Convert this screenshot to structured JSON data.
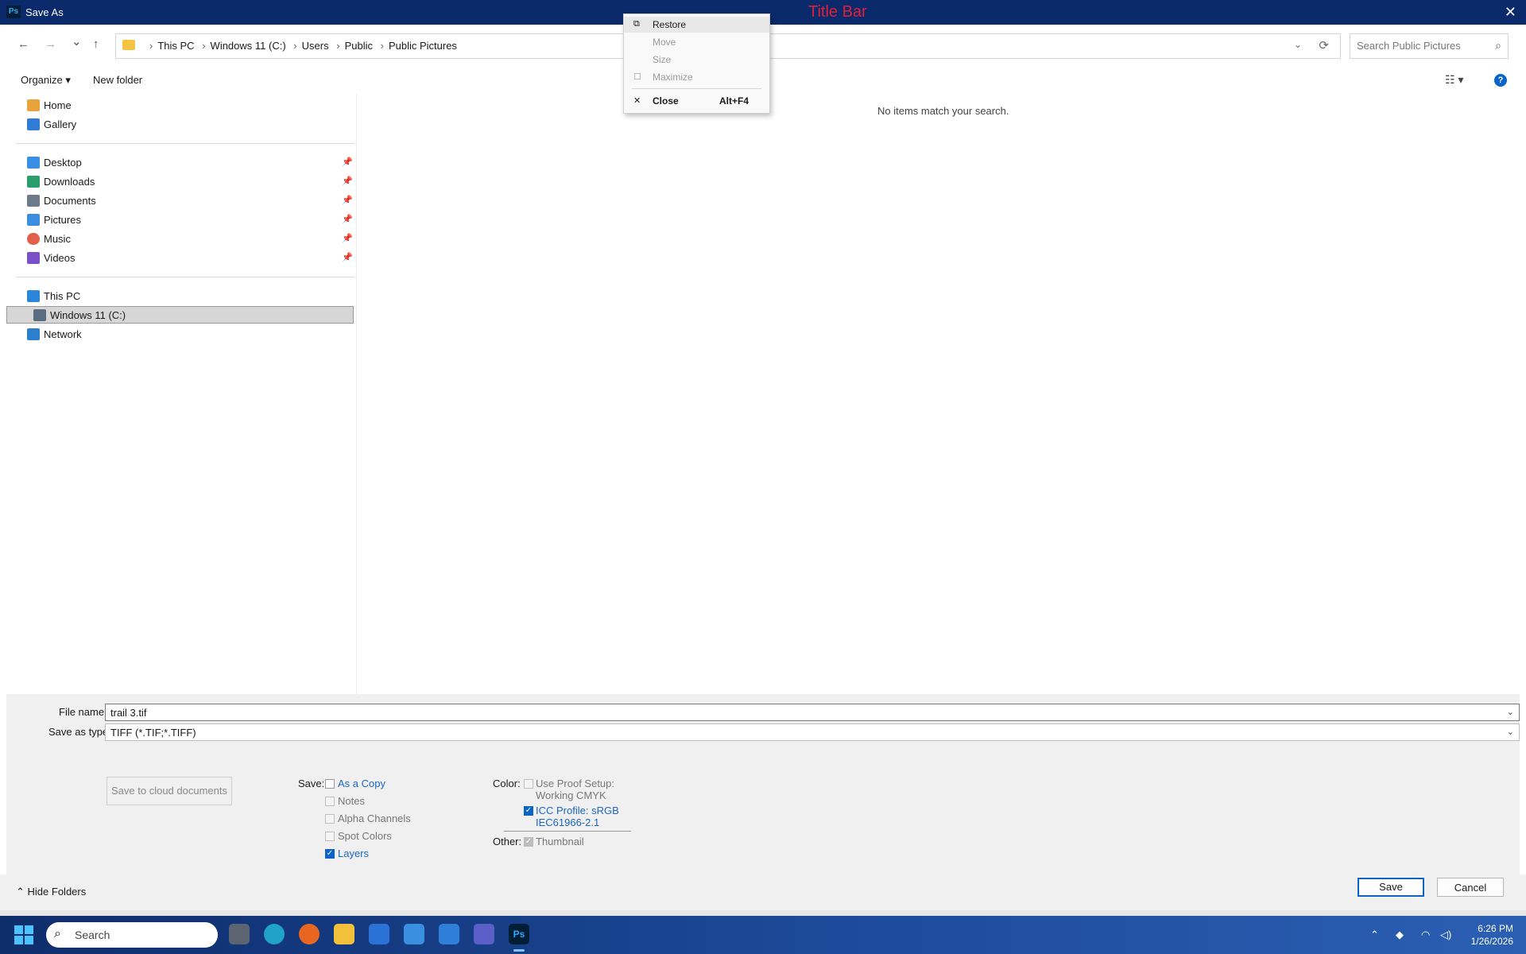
{
  "window": {
    "title": "Save As",
    "overlay_label": "Title Bar",
    "app_badge": "Ps",
    "close_glyph": "✕"
  },
  "nav": {
    "back_glyph": "←",
    "forward_glyph": "→",
    "recent_glyph": "⌄",
    "up_glyph": "↑",
    "breadcrumbs": [
      "This PC",
      "Windows 11 (C:)",
      "Users",
      "Public",
      "Public Pictures"
    ],
    "sep_glyph": "›",
    "search_placeholder": "Search Public Pictures"
  },
  "toolbar": {
    "organize": "Organize ▾",
    "new_folder": "New folder",
    "help": "?"
  },
  "sidebar": {
    "quick": [
      {
        "label": "Home",
        "icon": "home-icon",
        "color": "#e8a33c"
      },
      {
        "label": "Gallery",
        "icon": "gallery-icon",
        "color": "#2f7bd6"
      }
    ],
    "pinned": [
      {
        "label": "Desktop",
        "icon": "desktop-icon",
        "color": "#3a8ee6"
      },
      {
        "label": "Downloads",
        "icon": "downloads-icon",
        "color": "#2a9d6a"
      },
      {
        "label": "Documents",
        "icon": "documents-icon",
        "color": "#6c7a8a"
      },
      {
        "label": "Pictures",
        "icon": "pictures-icon",
        "color": "#3b8de0"
      },
      {
        "label": "Music",
        "icon": "music-icon",
        "color": "#e2604a"
      },
      {
        "label": "Videos",
        "icon": "videos-icon",
        "color": "#7b4fc9"
      }
    ],
    "pin_glyph": "📌",
    "pc": [
      {
        "label": "This PC",
        "icon": "this-pc-icon",
        "color": "#2b86d9"
      },
      {
        "label": "Windows 11 (C:)",
        "icon": "drive-icon",
        "color": "#5a6c80",
        "selected": true
      },
      {
        "label": "Network",
        "icon": "network-icon",
        "color": "#2c7fcf"
      }
    ]
  },
  "content": {
    "empty_message": "No items match your search."
  },
  "fields": {
    "file_name_label": "File name:",
    "file_name_value": "trail 3.tif",
    "save_type_label": "Save as type:",
    "save_type_value": "TIFF (*.TIF;*.TIFF)"
  },
  "options": {
    "cloud_button": "Save to cloud documents",
    "save_label": "Save:",
    "save_items": [
      {
        "label": "As a Copy",
        "checked": false,
        "enabled": true
      },
      {
        "label": "Notes",
        "checked": false,
        "enabled": false
      },
      {
        "label": "Alpha Channels",
        "checked": false,
        "enabled": false
      },
      {
        "label": "Spot Colors",
        "checked": false,
        "enabled": false
      },
      {
        "label": "Layers",
        "checked": true,
        "enabled": true
      }
    ],
    "color_label": "Color:",
    "proof_line1": "Use Proof Setup:",
    "proof_line2": "Working CMYK",
    "icc_line1": "ICC Profile:  sRGB",
    "icc_line2": "IEC61966-2.1",
    "other_label": "Other:",
    "thumbnail": "Thumbnail"
  },
  "footer": {
    "hide_folders": "Hide Folders",
    "save": "Save",
    "cancel": "Cancel"
  },
  "context_menu": {
    "items": [
      {
        "label": "Restore",
        "glyph": "⧉",
        "enabled": true
      },
      {
        "label": "Move",
        "glyph": "",
        "enabled": false
      },
      {
        "label": "Size",
        "glyph": "",
        "enabled": false
      },
      {
        "label": "Maximize",
        "glyph": "☐",
        "enabled": false
      },
      {
        "label": "Close",
        "glyph": "✕",
        "shortcut": "Alt+F4",
        "enabled": true
      }
    ]
  },
  "taskbar": {
    "search_placeholder": "Search",
    "time": "6:26 PM",
    "date": "1/26/2026",
    "apps": [
      {
        "name": "task-view",
        "color": "#5b6470"
      },
      {
        "name": "edge",
        "color": "#1fa3c9"
      },
      {
        "name": "firefox",
        "color": "#e8661f"
      },
      {
        "name": "file-explorer",
        "color": "#f2c13c"
      },
      {
        "name": "app-blue-1",
        "color": "#2c72d6"
      },
      {
        "name": "app-blue-2",
        "color": "#3b8fe0"
      },
      {
        "name": "store",
        "color": "#2f7fd8"
      },
      {
        "name": "teams",
        "color": "#5b5fc7"
      },
      {
        "name": "photoshop",
        "color": "#001e36"
      }
    ]
  }
}
